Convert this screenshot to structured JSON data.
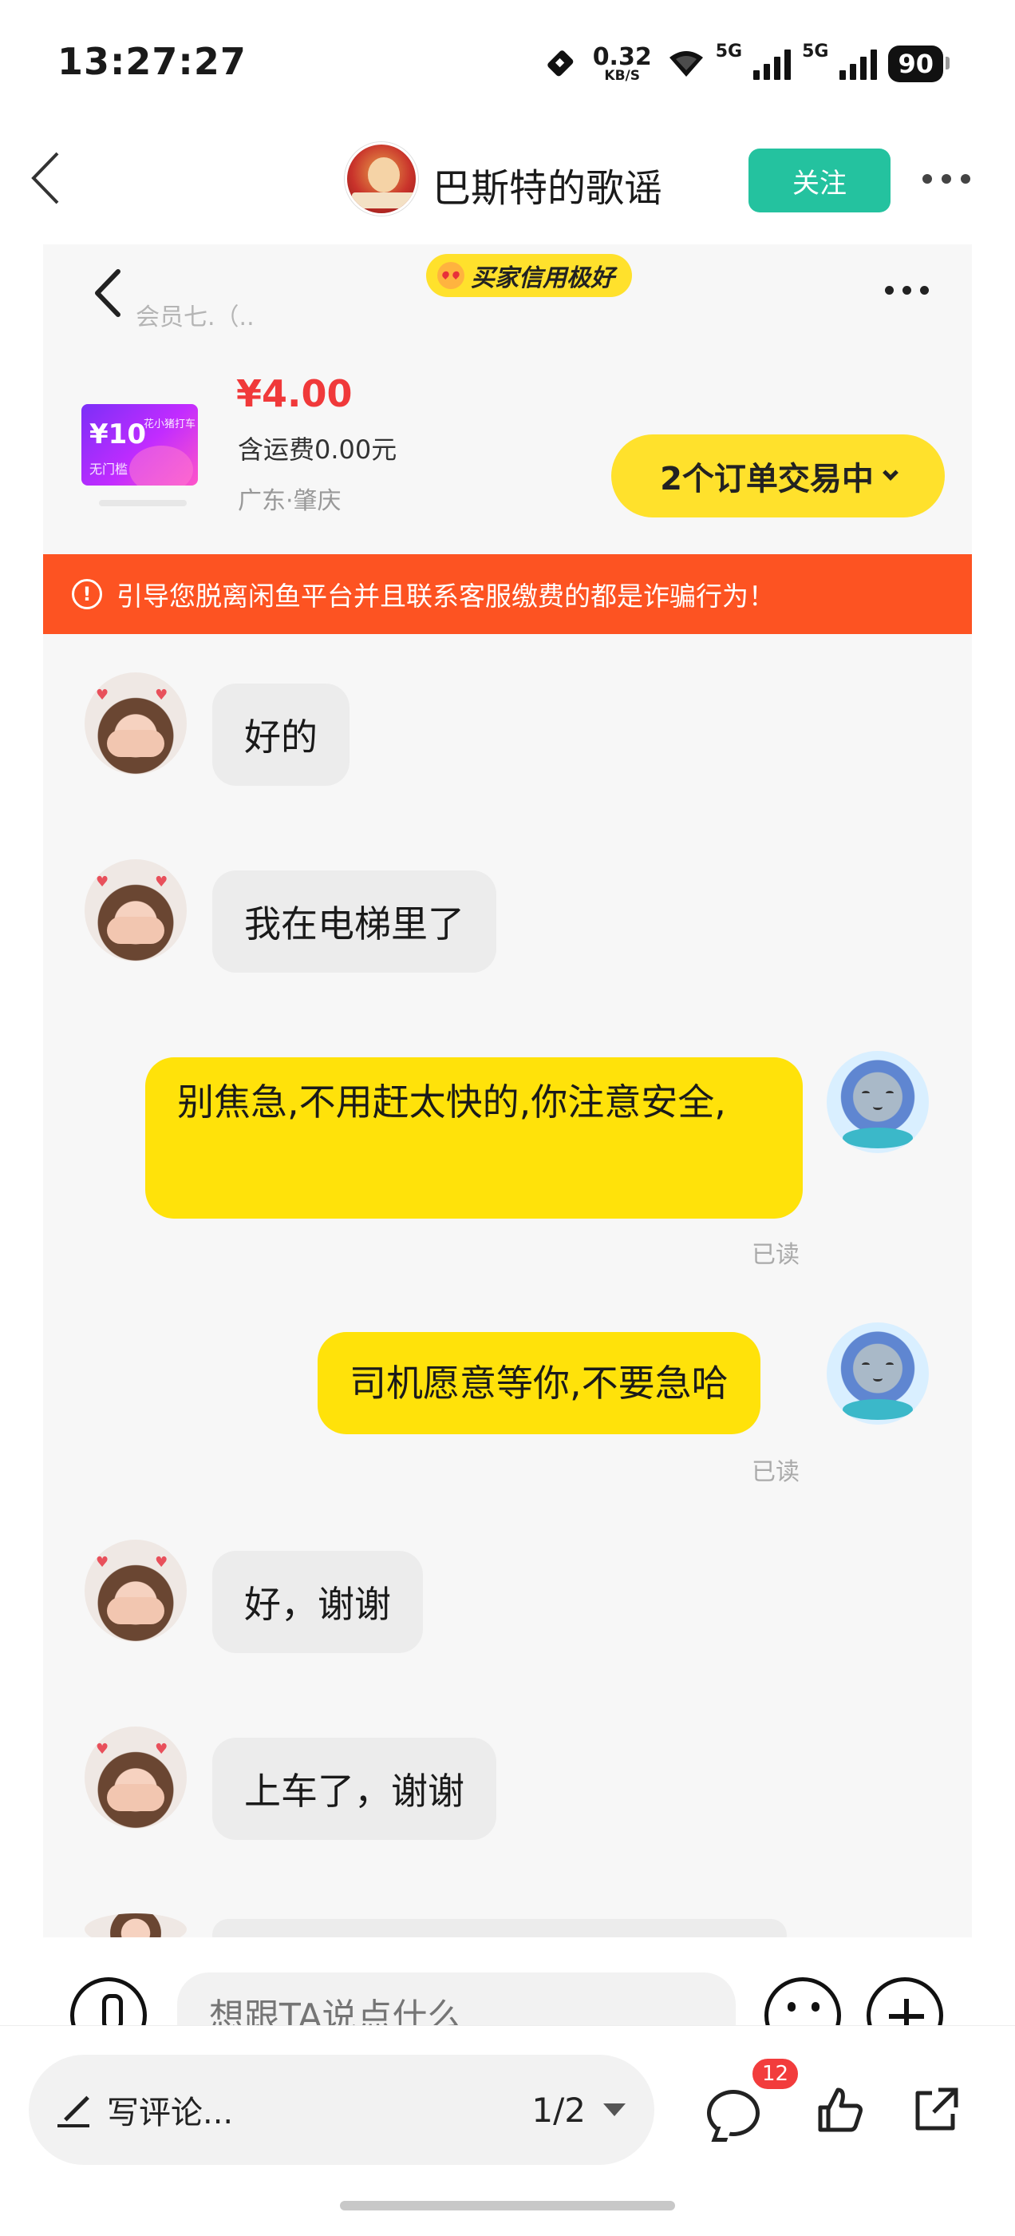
{
  "status_bar": {
    "time": "13:27:27",
    "net_speed_value": "0.32",
    "net_speed_unit": "KB/S",
    "signal_1_label": "5G",
    "signal_2_label": "5G",
    "battery": "90"
  },
  "header": {
    "author_name": "巴斯特的歌谣",
    "follow_label": "关注"
  },
  "chat": {
    "credit_badge": "买家信用极好",
    "member_text": "会员七.（..",
    "product": {
      "image_big": "¥10",
      "image_small": "花小猪打车",
      "image_tag": "无门槛",
      "price": "¥4.00",
      "shipping": "含运费0.00元",
      "location": "广东·肇庆"
    },
    "orders_label": "2个订单交易中",
    "warning": "引导您脱离闲鱼平台并且联系客服缴费的都是诈骗行为！",
    "messages": [
      {
        "side": "in",
        "text": "好的"
      },
      {
        "side": "in",
        "text": "我在电梯里了"
      },
      {
        "side": "out",
        "text": "别焦急,不用赶太快的,你注意安全,",
        "status": "已读"
      },
      {
        "side": "out",
        "text": "司机愿意等你,不要急哈",
        "status": "已读"
      },
      {
        "side": "in",
        "text": "好，谢谢"
      },
      {
        "side": "in",
        "text": "上车了，谢谢"
      }
    ],
    "input_placeholder": "想跟TA说点什么"
  },
  "bottom_bar": {
    "write_comment": "写评论...",
    "page_indicator": "1/2",
    "comment_count": "12"
  },
  "colors": {
    "follow_green": "#24c29f",
    "yellow": "#ffe20a",
    "warning_orange": "#fd5322",
    "price_red": "#f0393a",
    "badge_red": "#f23c3c"
  },
  "icons": [
    "back-arrow-icon",
    "more-icon",
    "chevron-down-icon",
    "warning-icon",
    "mic-icon",
    "emoji-icon",
    "plus-icon",
    "pen-icon",
    "comment-icon",
    "like-icon",
    "share-icon"
  ]
}
